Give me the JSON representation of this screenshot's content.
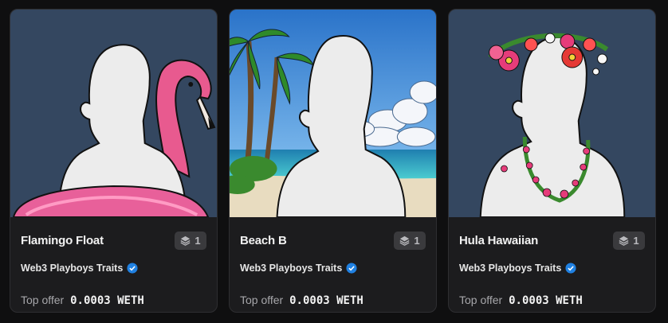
{
  "cards": [
    {
      "title": "Flamingo Float",
      "collection": "Web3 Playboys Traits",
      "quantity": "1",
      "offer_label": "Top offer",
      "offer_value": "0.0003 WETH"
    },
    {
      "title": "Beach B",
      "collection": "Web3 Playboys Traits",
      "quantity": "1",
      "offer_label": "Top offer",
      "offer_value": "0.0003 WETH"
    },
    {
      "title": "Hula Hawaiian",
      "collection": "Web3 Playboys Traits",
      "quantity": "1",
      "offer_label": "Top offer",
      "offer_value": "0.0003 WETH"
    }
  ],
  "colors": {
    "background": "#0f0f10",
    "card": "#1c1c1e",
    "verified": "#2081e2",
    "art_bg": "#344760"
  },
  "icons": {
    "quantity": "layers-icon",
    "verified": "verified-badge-icon"
  }
}
